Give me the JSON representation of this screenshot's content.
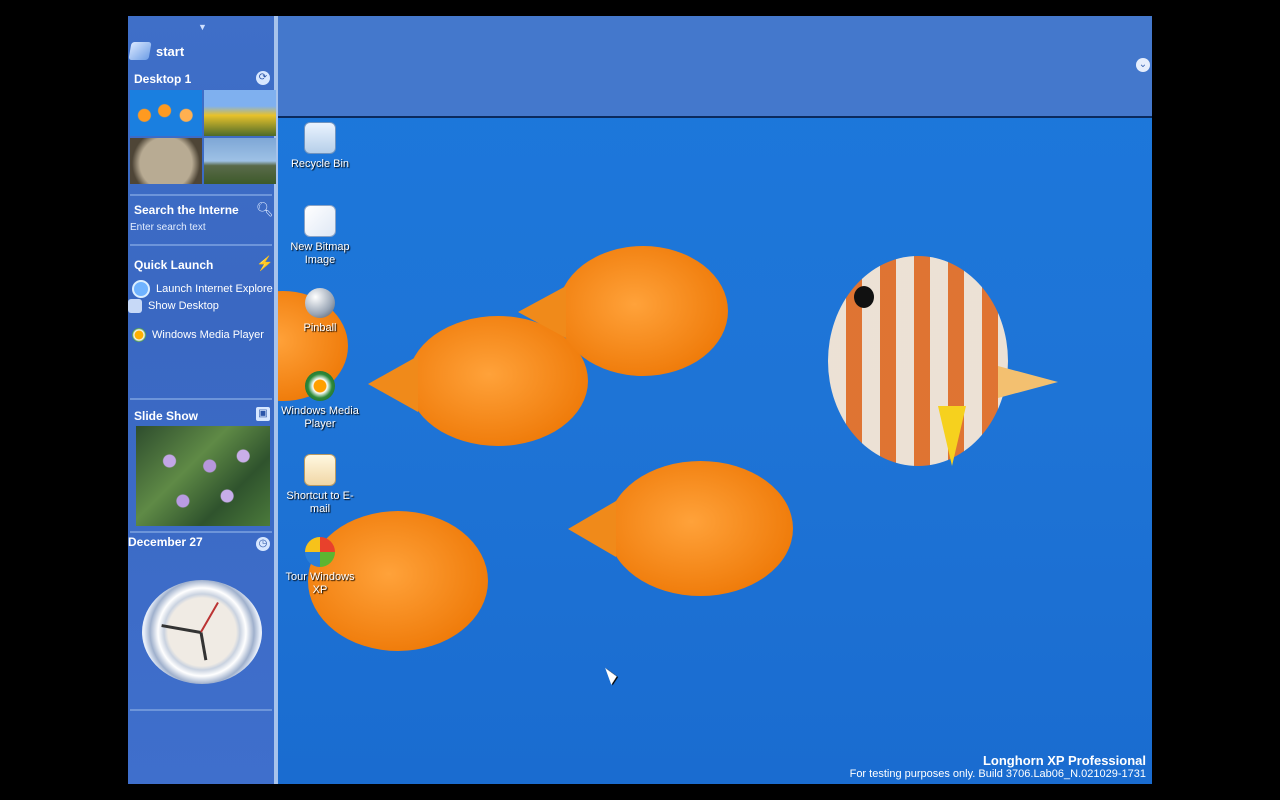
{
  "sidebar": {
    "start_label": "start",
    "desktop_title": "Desktop 1",
    "search_title": "Search the Interne",
    "search_placeholder": "Enter search text",
    "quick_launch_title": "Quick Launch",
    "quick_launch_items": [
      {
        "label": "Launch Internet Explore",
        "icon": "internet-explorer-icon"
      },
      {
        "label": "Show Desktop",
        "icon": "show-desktop-icon"
      },
      {
        "label": "Windows Media Player",
        "icon": "media-player-icon"
      }
    ],
    "slide_show_title": "Slide Show",
    "date_label": "December 27"
  },
  "desktop_icons": [
    {
      "label": "Recycle Bin",
      "icon": "recycle-bin-icon"
    },
    {
      "label": "New Bitmap Image",
      "icon": "bitmap-icon"
    },
    {
      "label": "Pinball",
      "icon": "pinball-icon"
    },
    {
      "label": "Windows Media Player",
      "icon": "media-player-icon"
    },
    {
      "label": "Shortcut to E-mail",
      "icon": "email-icon"
    },
    {
      "label": "Tour Windows XP",
      "icon": "tour-icon"
    }
  ],
  "watermark": {
    "line1": "Longhorn XP Professional",
    "line2": "For testing purposes only. Build 3706.Lab06_N.021029-1731"
  }
}
